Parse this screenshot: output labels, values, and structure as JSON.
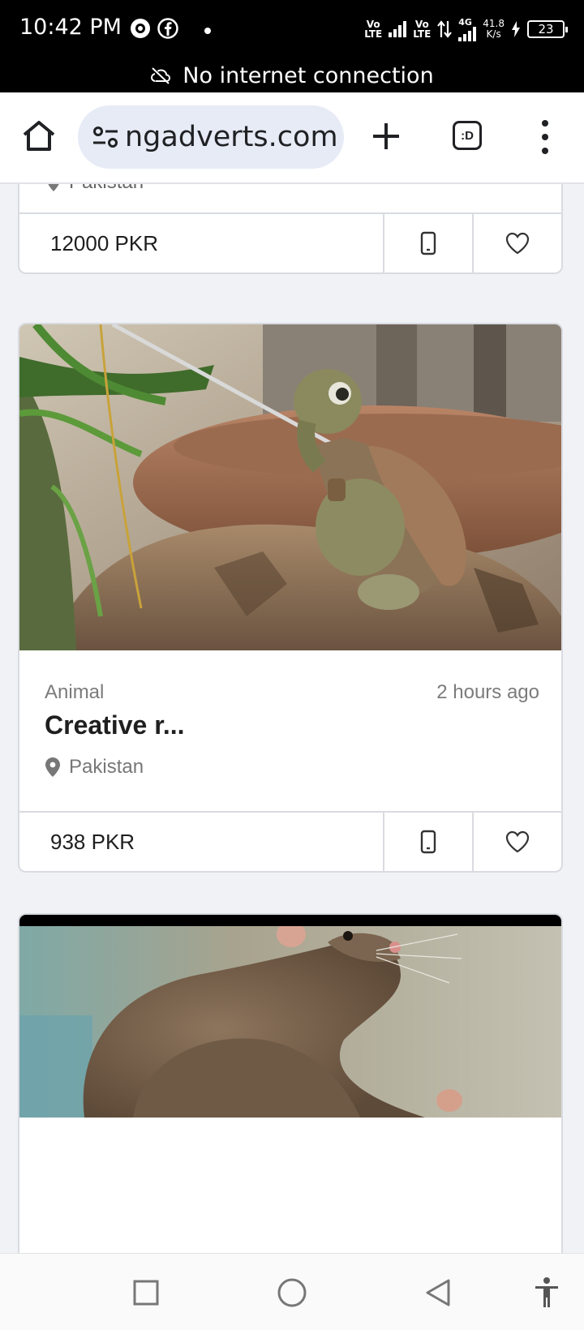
{
  "status_bar": {
    "time": "10:42 PM",
    "sim1": [
      "Vo",
      "LTE"
    ],
    "sim2": [
      "Vo",
      "LTE"
    ],
    "network_type": "4G",
    "speed_value": "41.8",
    "speed_unit": "K/s",
    "battery": "23",
    "app_icons": [
      "camera-sync-icon",
      "facebook-icon"
    ]
  },
  "offline_banner": {
    "text": "No internet connection",
    "icon": "cloud-off-icon"
  },
  "browser": {
    "url": "ngadverts.com",
    "tab_label": ":D"
  },
  "previous_listing": {
    "location": "Pakistan",
    "price": "12000 PKR"
  },
  "listing": {
    "category": "Animal",
    "posted": "2 hours ago",
    "title": "Creative r...",
    "location": "Pakistan",
    "price": "938 PKR"
  },
  "colors": {
    "status_bar": "#000000",
    "page_bg": "#f1f2f6",
    "url_pill": "#e6ebf6",
    "card_border": "#d9dbe1",
    "text_dark": "#1f1f1f",
    "text_muted": "#7b7b7b"
  }
}
